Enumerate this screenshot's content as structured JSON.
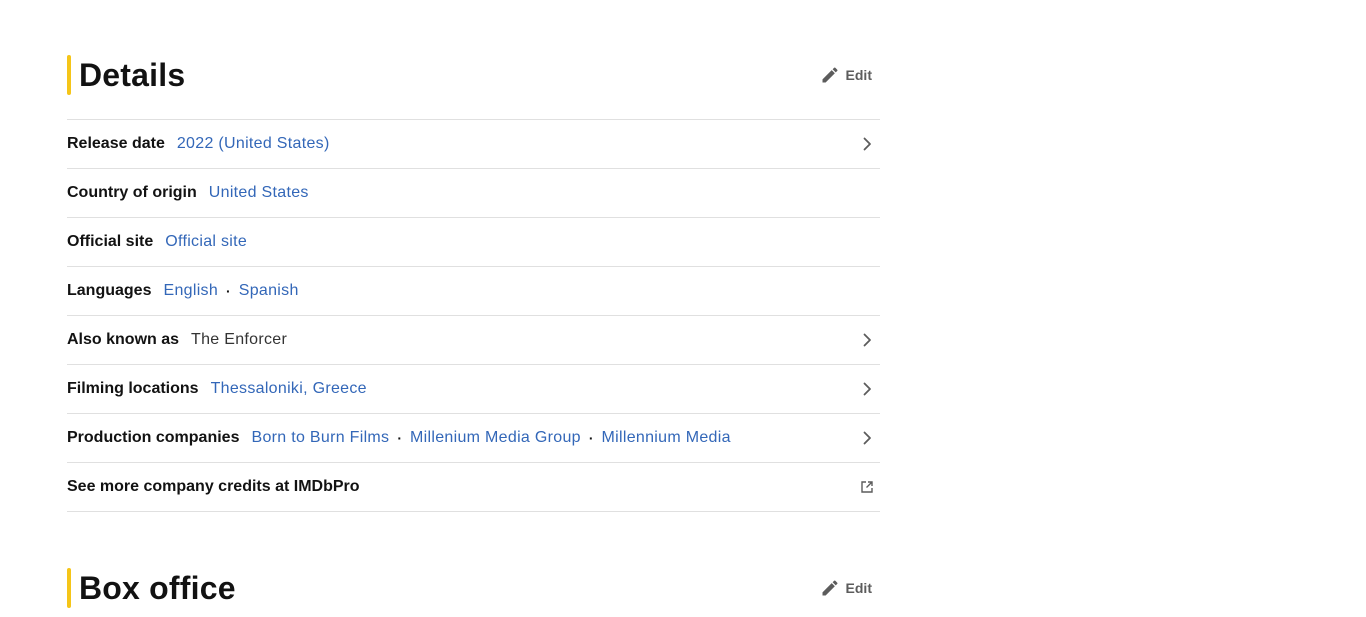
{
  "details": {
    "title": "Details",
    "edit_label": "Edit",
    "rows": {
      "release_date": {
        "label": "Release date",
        "values": [
          "2022 (United States)"
        ]
      },
      "country": {
        "label": "Country of origin",
        "values": [
          "United States"
        ]
      },
      "official_site": {
        "label": "Official site",
        "values": [
          "Official site"
        ]
      },
      "languages": {
        "label": "Languages",
        "values": [
          "English",
          "Spanish"
        ]
      },
      "aka": {
        "label": "Also known as",
        "values": [
          "The Enforcer"
        ]
      },
      "filming": {
        "label": "Filming locations",
        "values": [
          "Thessaloniki, Greece"
        ]
      },
      "companies": {
        "label": "Production companies",
        "values": [
          "Born to Burn Films",
          "Millenium Media Group",
          "Millennium Media"
        ]
      },
      "imdbpro": {
        "label": "See more company credits at IMDbPro"
      }
    },
    "separator": "·"
  },
  "box_office": {
    "title": "Box office",
    "edit_label": "Edit"
  },
  "icons": {
    "edit": "pencil-icon",
    "chevron": "chevron-right-icon",
    "external": "external-link-icon"
  },
  "colors": {
    "accent": "#f5c518",
    "link": "#3367b8",
    "divider": "#e0e0e0"
  }
}
